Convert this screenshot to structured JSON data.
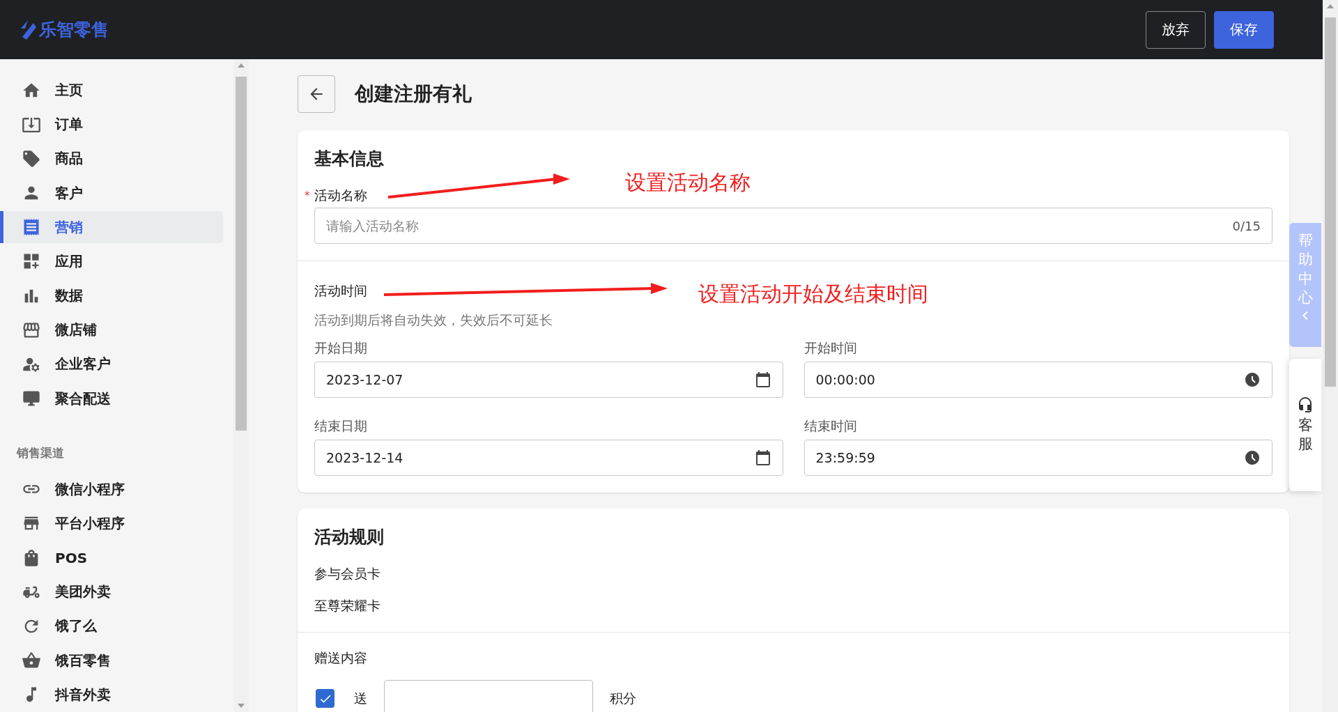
{
  "app": {
    "logo": "乐智零售"
  },
  "header": {
    "buttons": [
      {
        "label": "放弃",
        "kind": "secondary"
      },
      {
        "label": "保存",
        "kind": "primary"
      }
    ]
  },
  "sidebar": {
    "items": [
      {
        "label": "主页",
        "selected": false
      },
      {
        "label": "订单",
        "selected": false
      },
      {
        "label": "商品",
        "selected": false
      },
      {
        "label": "客户",
        "selected": false
      },
      {
        "label": "营销",
        "selected": true
      },
      {
        "label": "应用",
        "selected": false
      },
      {
        "label": "数据",
        "selected": false
      },
      {
        "label": "微店铺",
        "selected": false
      },
      {
        "label": "企业客户",
        "selected": false
      },
      {
        "label": "聚合配送",
        "selected": false
      }
    ],
    "section_title": "销售渠道",
    "channels": [
      {
        "label": "微信小程序",
        "selected": false
      },
      {
        "label": "平台小程序",
        "selected": false
      },
      {
        "label": "POS",
        "selected": false
      },
      {
        "label": "美团外卖",
        "selected": false
      },
      {
        "label": "饿了么",
        "selected": false
      },
      {
        "label": "饿百零售",
        "selected": false
      },
      {
        "label": "抖音外卖",
        "selected": false
      }
    ]
  },
  "page": {
    "title": "创建注册有礼"
  },
  "basic_info": {
    "title": "基本信息",
    "name_field": {
      "label": "活动名称",
      "required_mark": "*",
      "placeholder": "请输入活动名称",
      "counter": "0/15"
    },
    "time": {
      "label": "活动时间",
      "hint": "活动到期后将自动失效，失效后不可延长",
      "fields": [
        {
          "label": "开始日期",
          "value": "2023-12-07",
          "kind": "date"
        },
        {
          "label": "开始时间",
          "value": "00:00:00",
          "kind": "time"
        },
        {
          "label": "结束日期",
          "value": "2023-12-14",
          "kind": "date"
        },
        {
          "label": "结束时间",
          "value": "23:59:59",
          "kind": "time"
        }
      ]
    }
  },
  "rules": {
    "title": "活动规则",
    "member_card_label": "参与会员卡",
    "member_card": "至尊荣耀卡",
    "gift_label": "赠送内容",
    "gift": {
      "checked": true,
      "prefix": "送",
      "suffix": "积分"
    }
  },
  "annotations": [
    {
      "text": "设置活动名称"
    },
    {
      "text": "设置活动开始及结束时间"
    }
  ],
  "help": {
    "label": "帮助中心",
    "service": "客服"
  }
}
